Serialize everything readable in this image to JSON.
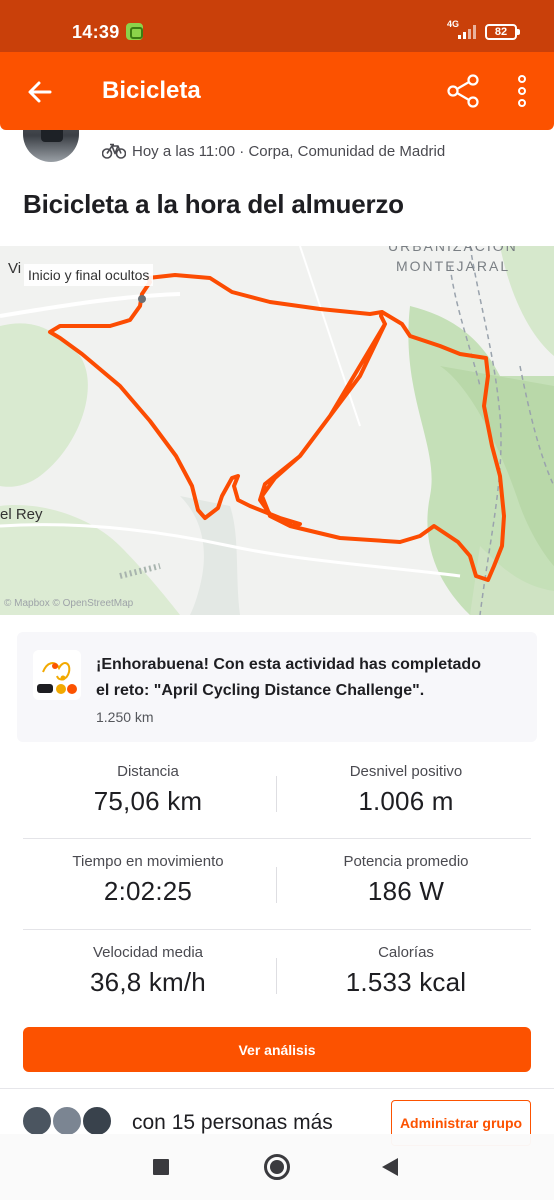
{
  "status_bar": {
    "time": "14:39",
    "network": "4G",
    "battery": "82"
  },
  "app_bar": {
    "title": "Bicicleta"
  },
  "activity": {
    "meta": "Hoy a las 11:00 · Corpa, Comunidad de Madrid",
    "title": "Bicicleta a la hora del almuerzo"
  },
  "map": {
    "hidden_label": "Inicio y final ocultos",
    "place_left_top": "Vi",
    "place_left": "el Rey",
    "urbanization_line1": "URBANIZACION",
    "urbanization_line2": "MONTEJARAL",
    "credit": "© Mapbox © OpenStreetMap",
    "route_color": "#fc4c02"
  },
  "challenge": {
    "line1": "¡Enhorabuena! Con esta actividad has completado",
    "line2": "el reto: \"April Cycling Distance Challenge\".",
    "distance": "1.250 km"
  },
  "stats": [
    {
      "label": "Distancia",
      "value": "75,06 km"
    },
    {
      "label": "Desnivel positivo",
      "value": "1.006 m"
    },
    {
      "label": "Tiempo en movimiento",
      "value": "2:02:25"
    },
    {
      "label": "Potencia promedio",
      "value": "186 W"
    },
    {
      "label": "Velocidad media",
      "value": "36,8 km/h"
    },
    {
      "label": "Calorías",
      "value": "1.533 kcal"
    }
  ],
  "actions": {
    "analysis_button": "Ver análisis",
    "group_text": "con 15 personas más",
    "manage_group_button": "Administrar grupo"
  },
  "colors": {
    "brand": "#fc5200",
    "status_bar": "#c9400a"
  }
}
